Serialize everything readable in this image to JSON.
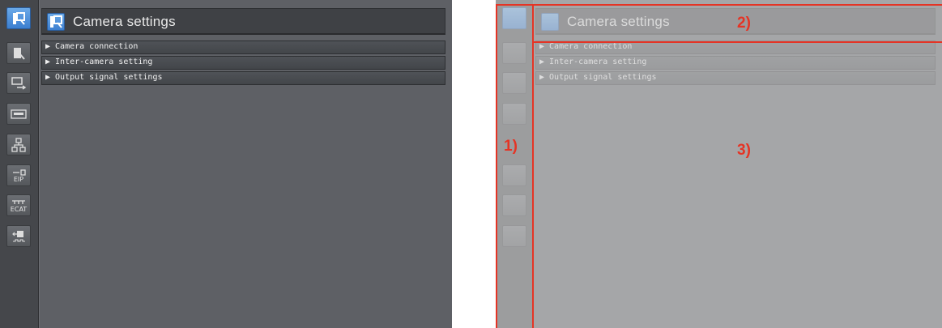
{
  "panels": [
    {
      "header": {
        "title": "Camera settings"
      },
      "sections": [
        "▶ Camera connection",
        "▶ Inter-camera setting",
        "▶ Output signal settings"
      ]
    }
  ],
  "toolbar": {
    "buttons": [
      {
        "icon": "camera-settings-icon",
        "active": true
      },
      {
        "icon": "system-settings-icon",
        "active": false
      },
      {
        "icon": "data-transfer-icon",
        "active": false
      },
      {
        "icon": "keyboard-icon",
        "active": false
      },
      {
        "icon": "network-icon",
        "active": false
      },
      {
        "icon": "eip-icon",
        "label": "EIP",
        "active": false
      },
      {
        "icon": "ecat-icon",
        "label": "ECAT",
        "active": false
      },
      {
        "icon": "io-signal-icon",
        "active": false
      }
    ]
  },
  "annotations": {
    "markers": [
      "1)",
      "2)",
      "3)"
    ],
    "color": "#e53425"
  },
  "colors": {
    "accent": "#3c7fd0",
    "panel": "#5e6065",
    "toolbar": "#45474b"
  }
}
